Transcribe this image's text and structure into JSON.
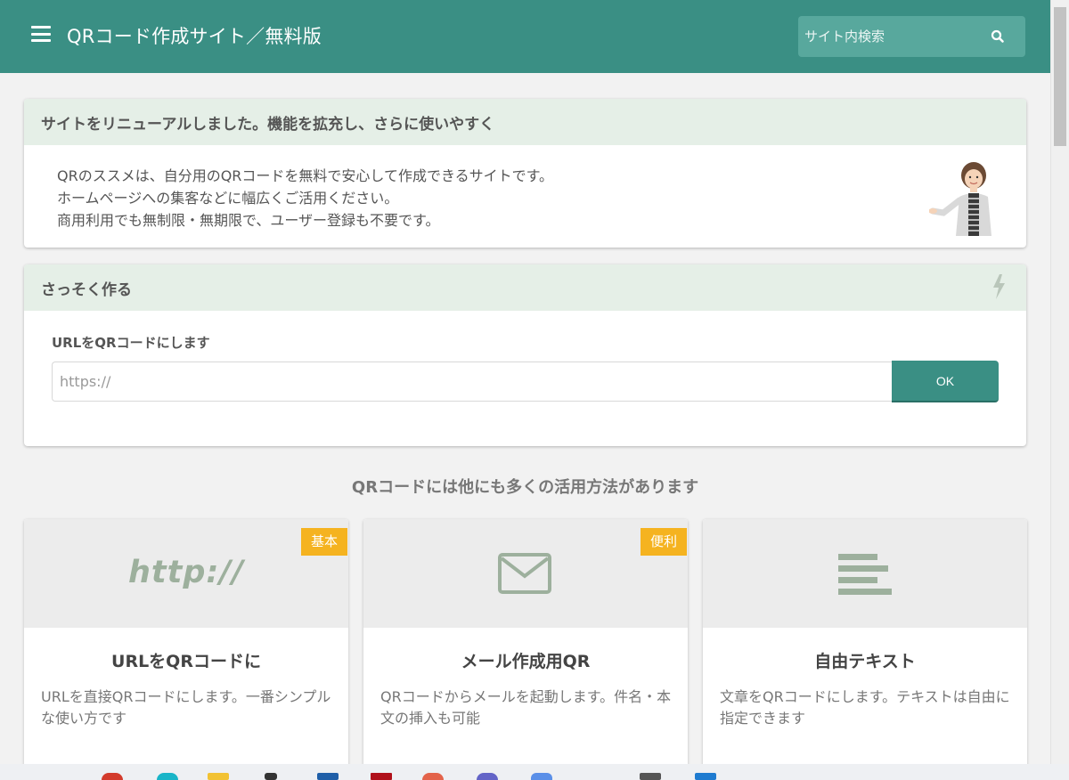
{
  "header": {
    "title": "QRコード作成サイト／無料版",
    "search_placeholder": "サイト内検索"
  },
  "notice": {
    "title": "サイトをリニューアルしました。機能を拡充し、さらに使いやすく",
    "lines": [
      "QRのススメは、自分用のQRコードを無料で安心して作成できるサイトです。",
      "ホームページへの集客などに幅広くご活用ください。",
      "商用利用でも無制限・無期限で、ユーザー登録も不要です。"
    ]
  },
  "make": {
    "title": "さっそく作る",
    "label": "URLをQRコードにします",
    "placeholder": "https://",
    "ok_label": "OK"
  },
  "section_title": "QRコードには他にも多くの活用方法があります",
  "tiles": [
    {
      "badge": "基本",
      "image_text": "http://",
      "title": "URLをQRコードに",
      "desc": "URLを直接QRコードにします。一番シンプルな使い方です"
    },
    {
      "badge": "便利",
      "icon": "mail-icon",
      "title": "メール作成用QR",
      "desc": "QRコードからメールを起動します。件名・本文の挿入も可能"
    },
    {
      "icon": "text-lines-icon",
      "title": "自由テキスト",
      "desc": "文章をQRコードにします。テキストは自由に指定できます"
    }
  ],
  "colors": {
    "primary": "#3a8f84",
    "card_header": "#e5efe7",
    "badge": "#f5b320",
    "icon_sage": "#9db09d"
  }
}
